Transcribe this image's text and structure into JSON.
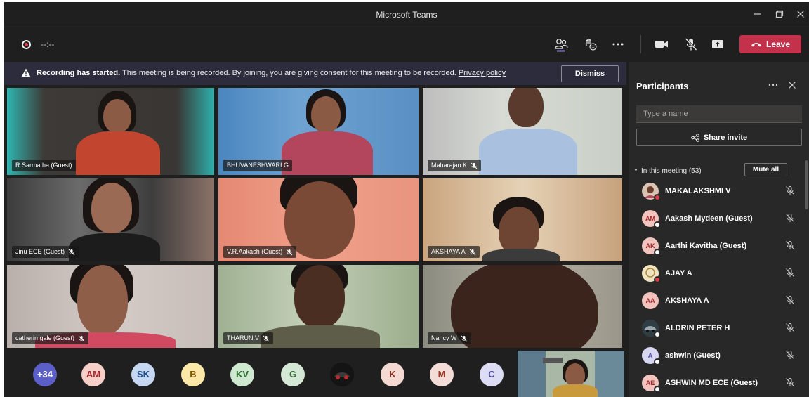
{
  "window": {
    "title": "Microsoft Teams"
  },
  "toolbar": {
    "timer": "--:--",
    "leave_label": "Leave"
  },
  "banner": {
    "bold": "Recording has started.",
    "message": " This meeting is being recorded. By joining, you are giving consent for this meeting to be recorded. ",
    "link": "Privacy policy",
    "dismiss_label": "Dismiss"
  },
  "tiles": [
    {
      "name": "R.Sarmatha (Guest)",
      "muted": false
    },
    {
      "name": "BHUVANESHWARI G",
      "muted": false
    },
    {
      "name": "Maharajan K",
      "muted": true
    },
    {
      "name": "Jinu ECE (Guest)",
      "muted": true
    },
    {
      "name": "V.R.Aakash (Guest)",
      "muted": true
    },
    {
      "name": "AKSHAYA A",
      "muted": true
    },
    {
      "name": "catherin gale (Guest)",
      "muted": true
    },
    {
      "name": "THARUN.V",
      "muted": true
    },
    {
      "name": "Nancy W",
      "muted": true
    }
  ],
  "overflow": {
    "label": "+34"
  },
  "avatars": [
    {
      "initials": "AM",
      "bg": "#f6cfc9",
      "fg": "#a4262c"
    },
    {
      "initials": "SK",
      "bg": "#c6d7f1",
      "fg": "#1f4e8c"
    },
    {
      "initials": "B",
      "bg": "#fbe8a8",
      "fg": "#8a5a00"
    },
    {
      "initials": "KV",
      "bg": "#cfe8d0",
      "fg": "#2b6c2f"
    },
    {
      "initials": "G",
      "bg": "#d5e7d5",
      "fg": "#3a6b3a"
    },
    {
      "initials": "",
      "bg": "#111111",
      "fg": "#ffffff"
    },
    {
      "initials": "K",
      "bg": "#f4d9d3",
      "fg": "#8a2f1f"
    },
    {
      "initials": "M",
      "bg": "#f3dcd7",
      "fg": "#9b3a2a"
    },
    {
      "initials": "C",
      "bg": "#dcdcf5",
      "fg": "#4b4b9c"
    }
  ],
  "panel": {
    "title": "Participants",
    "search_placeholder": "Type a name",
    "share_label": "Share invite",
    "section_label": "In this meeting (53)",
    "mute_all_label": "Mute all",
    "participants": [
      {
        "name": "MAKALAKSHMI V",
        "initials": "",
        "photo": true,
        "color": "#8d5a43"
      },
      {
        "name": "Aakash Mydeen (Guest)",
        "initials": "AM",
        "photo": false,
        "color": "#f2c4bd",
        "fg": "#a4262c"
      },
      {
        "name": "Aarthi Kavitha (Guest)",
        "initials": "AK",
        "photo": false,
        "color": "#f2c4bd",
        "fg": "#a4262c"
      },
      {
        "name": "AJAY A",
        "initials": "",
        "photo": true,
        "color": "#e9d8a6"
      },
      {
        "name": "AKSHAYA A",
        "initials": "AA",
        "photo": false,
        "color": "#f2c4bd",
        "fg": "#a4262c"
      },
      {
        "name": "ALDRIN PETER H",
        "initials": "",
        "photo": true,
        "color": "#3a4d57"
      },
      {
        "name": "ashwin (Guest)",
        "initials": "A",
        "photo": false,
        "color": "#d7d6f3",
        "fg": "#4b4b9c"
      },
      {
        "name": "ASHWIN MD ECE (Guest)",
        "initials": "AE",
        "photo": false,
        "color": "#f2c4bd",
        "fg": "#a4262c"
      }
    ]
  },
  "colors": {
    "leave": "#c4314b",
    "banner": "#2d2c3c",
    "panel": "#292828"
  }
}
